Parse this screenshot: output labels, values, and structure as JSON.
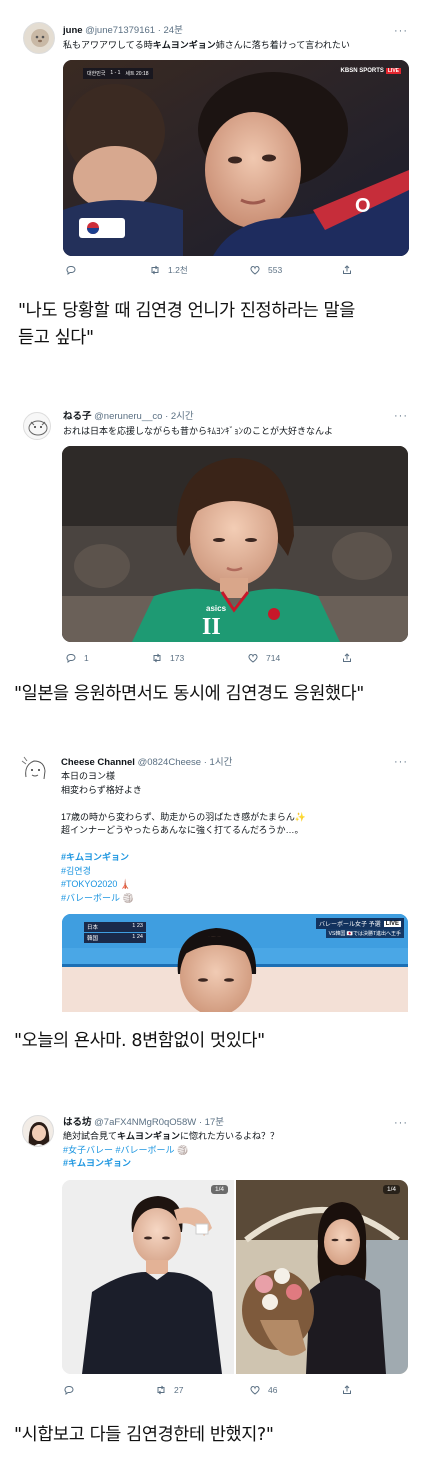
{
  "tweets": [
    {
      "name": "june",
      "handle": "@june71379161",
      "time": "24분",
      "text_pre": "私もアワアワしてる時",
      "text_hl": "キムヨンギョン",
      "text_post": "姉さんに落ち着けって言われたい",
      "broadcast": {
        "logo": "KBSN SPORTS",
        "live": "LIVE",
        "flag": "대한민국",
        "score": "1 - 1",
        "board": "세트 20:18"
      },
      "actions": {
        "reply": "",
        "retweet": "1.2천",
        "like": "553"
      }
    },
    {
      "name": "ねる子",
      "handle": "@neruneru__co",
      "time": "2시간",
      "text": "おれは日本を応援しながらも昔からｷﾑﾖﾝｷﾞｮﾝのことが大好きなんよ",
      "jersey_text": "asics",
      "actions": {
        "reply": "1",
        "retweet": "173",
        "like": "714"
      }
    },
    {
      "name": "Cheese Channel",
      "handle": "@0824Cheese",
      "time": "1시간",
      "lines": [
        "本日のヨン様",
        "相変わらず格好よき",
        "",
        "17歳の時から変わらず、助走からの羽ばたき感がたまらん✨",
        "超インナーどうやったらあんなに強く打てるんだろうか…。"
      ],
      "tags": [
        "#キムヨンギョン",
        "#김연경",
        "#TOKYO2020 🗼",
        "#バレーボール 🏐"
      ],
      "broadcast": {
        "title": "バレーボール女子 予選",
        "live": "LIVE",
        "row1": "日本",
        "row2": "韓国",
        "sub": "VS韓国 🇯🇵では決勝T進出へ王手"
      }
    },
    {
      "name": "はる坊",
      "handle": "@7aFX4NMgR0qO58W",
      "time": "17분",
      "text_pre": "絶対試合見て",
      "text_hl": "キムヨンギョン",
      "text_post": "に惚れた方いるよね？？",
      "tags_line": "#女子バレー #バレーボール 🏐",
      "tag_bold": "#キムヨンギョン",
      "photo_badge": "1/4",
      "actions": {
        "reply": "",
        "retweet": "27",
        "like": "46"
      }
    }
  ],
  "captions": [
    "\"나도 당황할 때 김연경 언니가 진정하라는 말을",
    "듣고 싶다\"",
    "\"일본을 응원하면서도 동시에 김연경도 응원했다\"",
    "\"오늘의 욘사마. 8변함없이 멋있다\"",
    "\"시합보고 다들 김연경한테 반했지?\""
  ],
  "colors": {
    "link": "#1b95e0",
    "muted": "#5b7083",
    "text": "#0f1419",
    "accent_red": "#cd2e3a",
    "jersey_green": "#1e9a73"
  },
  "icons": [
    "avatar",
    "more-icon",
    "reply-icon",
    "retweet-icon",
    "like-icon",
    "share-icon"
  ]
}
